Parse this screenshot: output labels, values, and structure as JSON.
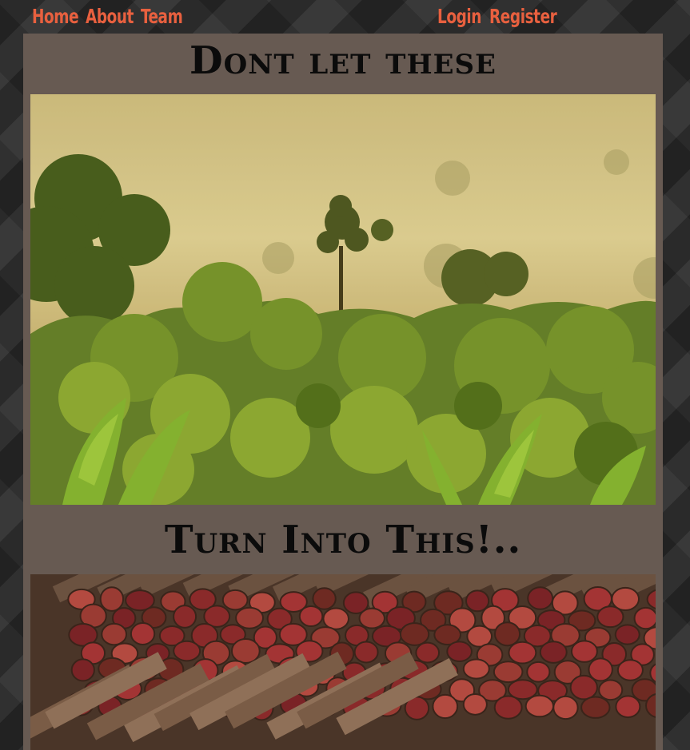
{
  "nav": {
    "links_left": [
      "Home",
      "About",
      "Team"
    ],
    "links_right": [
      "Login",
      "Register"
    ]
  },
  "sections": [
    {
      "heading": "Dont let these",
      "image": "misty-rainforest-landscape"
    },
    {
      "heading": "Turn Into This!..",
      "image": "stacked-cut-logs"
    }
  ],
  "colors": {
    "background": "#2f2f2f",
    "panel": "#675a52",
    "nav_link": "#e8603f",
    "heading": "#0b0b0b"
  }
}
